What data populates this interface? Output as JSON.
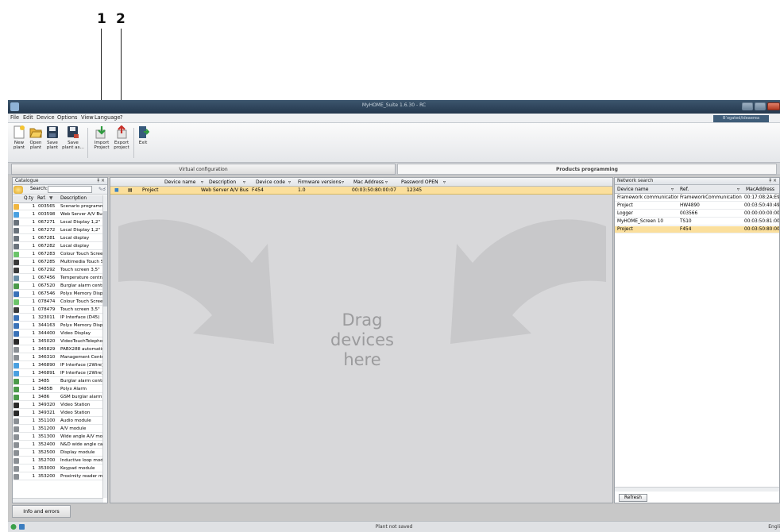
{
  "callouts": [
    {
      "label": "1",
      "target": "import-project-button"
    },
    {
      "label": "2",
      "target": "export-project-button"
    }
  ],
  "window": {
    "title": "MyHOME_Suite 1.6.30 - RC",
    "user_badge": "B’ogated/ideaerea"
  },
  "menu": [
    "File",
    "Edit",
    "Device",
    "Options",
    "View",
    "Language",
    "?"
  ],
  "toolbar": [
    {
      "id": "new_plant",
      "label": "New\nplant",
      "icon": "new-document-icon"
    },
    {
      "id": "open_plant",
      "label": "Open\nplant",
      "icon": "folder-open-icon"
    },
    {
      "id": "save_plant",
      "label": "Save\nplant",
      "icon": "floppy-save-icon"
    },
    {
      "id": "save_plant_as",
      "label": "Save\nplant as...",
      "icon": "floppy-save-as-icon"
    },
    {
      "id": "import_project",
      "label": "Import\nProject",
      "icon": "import-arrow-icon"
    },
    {
      "id": "export_project",
      "label": "Export\nproject",
      "icon": "export-arrow-icon"
    },
    {
      "id": "exit",
      "label": "Exit",
      "icon": "exit-door-icon"
    }
  ],
  "tabs": {
    "virtual": "Virtual configuration",
    "products": "Products programming"
  },
  "catalogue": {
    "title": "Catalogue",
    "pin": "‡ ×",
    "search_label": "Search:",
    "columns": [
      "Q.ty",
      "Ref.",
      "Description"
    ],
    "rows": [
      {
        "qty": "1",
        "ref": "003565",
        "desc": "Scenario programmer",
        "color": "#f0b640"
      },
      {
        "qty": "1",
        "ref": "003598",
        "desc": "Web Server A/V Bus",
        "color": "#4aa0e0"
      },
      {
        "qty": "1",
        "ref": "067271",
        "desc": "Local Display 1,2\"",
        "color": "#6a737c"
      },
      {
        "qty": "1",
        "ref": "067272",
        "desc": "Local Display 1,2\"",
        "color": "#6a737c"
      },
      {
        "qty": "1",
        "ref": "067281",
        "desc": "Local display",
        "color": "#6a737c"
      },
      {
        "qty": "1",
        "ref": "067282",
        "desc": "Local display",
        "color": "#6a737c"
      },
      {
        "qty": "1",
        "ref": "067283",
        "desc": "Colour Touch Screen",
        "color": "#6cc46a"
      },
      {
        "qty": "1",
        "ref": "067285",
        "desc": "Multimedia Touch Screen",
        "color": "#3a3a3a"
      },
      {
        "qty": "1",
        "ref": "067292",
        "desc": "Touch screen 3,5\"",
        "color": "#3a3a3a"
      },
      {
        "qty": "1",
        "ref": "067456",
        "desc": "Temperature central",
        "color": "#6a8fa8"
      },
      {
        "qty": "1",
        "ref": "067520",
        "desc": "Burglar alarm central",
        "color": "#4b9a4a"
      },
      {
        "qty": "1",
        "ref": "067546",
        "desc": "Polyx Memory Display",
        "color": "#3a72b8"
      },
      {
        "qty": "1",
        "ref": "078474",
        "desc": "Colour Touch Screen",
        "color": "#6cc46a"
      },
      {
        "qty": "1",
        "ref": "078479",
        "desc": "Touch screen 3,5\"",
        "color": "#3a3a3a"
      },
      {
        "qty": "1",
        "ref": "323011",
        "desc": "IP Interface (D45)",
        "color": "#3a72b8"
      },
      {
        "qty": "1",
        "ref": "344163",
        "desc": "Polyx Memory Display",
        "color": "#3a72b8"
      },
      {
        "qty": "1",
        "ref": "344400",
        "desc": "Video Display",
        "color": "#3a72b8"
      },
      {
        "qty": "1",
        "ref": "345020",
        "desc": "VideoTouchTelephone",
        "color": "#2a2a2a"
      },
      {
        "qty": "1",
        "ref": "345829",
        "desc": "PABX288 automatic",
        "color": "#8a8f94"
      },
      {
        "qty": "1",
        "ref": "346310",
        "desc": "Management Centre",
        "color": "#8a8f94"
      },
      {
        "qty": "1",
        "ref": "346890",
        "desc": "IP Interface (2Wire)",
        "color": "#4aa0e0"
      },
      {
        "qty": "1",
        "ref": "346891",
        "desc": "IP Interface (2Wire)",
        "color": "#4aa0e0"
      },
      {
        "qty": "1",
        "ref": "3485",
        "desc": "Burglar alarm central",
        "color": "#4b9a4a"
      },
      {
        "qty": "1",
        "ref": "3485B",
        "desc": "Polyx Alarm",
        "color": "#4b9a4a"
      },
      {
        "qty": "1",
        "ref": "3486",
        "desc": "GSM burglar alarm",
        "color": "#4b9a4a"
      },
      {
        "qty": "1",
        "ref": "349320",
        "desc": "Video Station",
        "color": "#2a2a2a"
      },
      {
        "qty": "1",
        "ref": "349321",
        "desc": "Video Station",
        "color": "#2a2a2a"
      },
      {
        "qty": "1",
        "ref": "351100",
        "desc": "Audio module",
        "color": "#8a8f94"
      },
      {
        "qty": "1",
        "ref": "351200",
        "desc": "A/V module",
        "color": "#8a8f94"
      },
      {
        "qty": "1",
        "ref": "351300",
        "desc": "Wide angle A/V module",
        "color": "#8a8f94"
      },
      {
        "qty": "1",
        "ref": "352400",
        "desc": "N&D wide angle camera",
        "color": "#8a8f94"
      },
      {
        "qty": "1",
        "ref": "352500",
        "desc": "Display module",
        "color": "#8a8f94"
      },
      {
        "qty": "1",
        "ref": "352700",
        "desc": "Inductive loop module",
        "color": "#8a8f94"
      },
      {
        "qty": "1",
        "ref": "353000",
        "desc": "Keypad module",
        "color": "#8a8f94"
      },
      {
        "qty": "1",
        "ref": "353200",
        "desc": "Proximity reader module",
        "color": "#8a8f94"
      }
    ]
  },
  "center": {
    "columns": [
      "Device name",
      "Description",
      "Device code",
      "Firmware versions",
      "Mac Address",
      "Password OPEN"
    ],
    "row": {
      "device_name": "Project",
      "description": "Web Server A/V Bus",
      "device_code": "F454",
      "firmware": "1.0",
      "mac": "00:03:50:80:00:07",
      "password": "12345"
    },
    "drop_text": "Drag\ndevices\nhere"
  },
  "network": {
    "title": "Network search",
    "pin": "‡ ×",
    "columns": [
      "Device name",
      "Ref.",
      "MacAddress"
    ],
    "rows": [
      {
        "name": "Framework communication",
        "ref": "FrameworkCommunication",
        "mac": "00:17:08:2A:E9:",
        "selected": false
      },
      {
        "name": "Project",
        "ref": "HW4890",
        "mac": "00:03:50:40:49:",
        "selected": false
      },
      {
        "name": "Logger",
        "ref": "003566",
        "mac": "00:00:00:00:00:",
        "selected": false
      },
      {
        "name": "MyHOME_Screen 10",
        "ref": "TS10",
        "mac": "00:03:50:81:00:",
        "selected": false
      },
      {
        "name": "Project",
        "ref": "F454",
        "mac": "00:03:50:80:00:",
        "selected": true
      }
    ],
    "refresh_label": "Refresh"
  },
  "info_tab": "Info and errors",
  "status": {
    "text": "Plant not saved",
    "language": "Engli"
  }
}
